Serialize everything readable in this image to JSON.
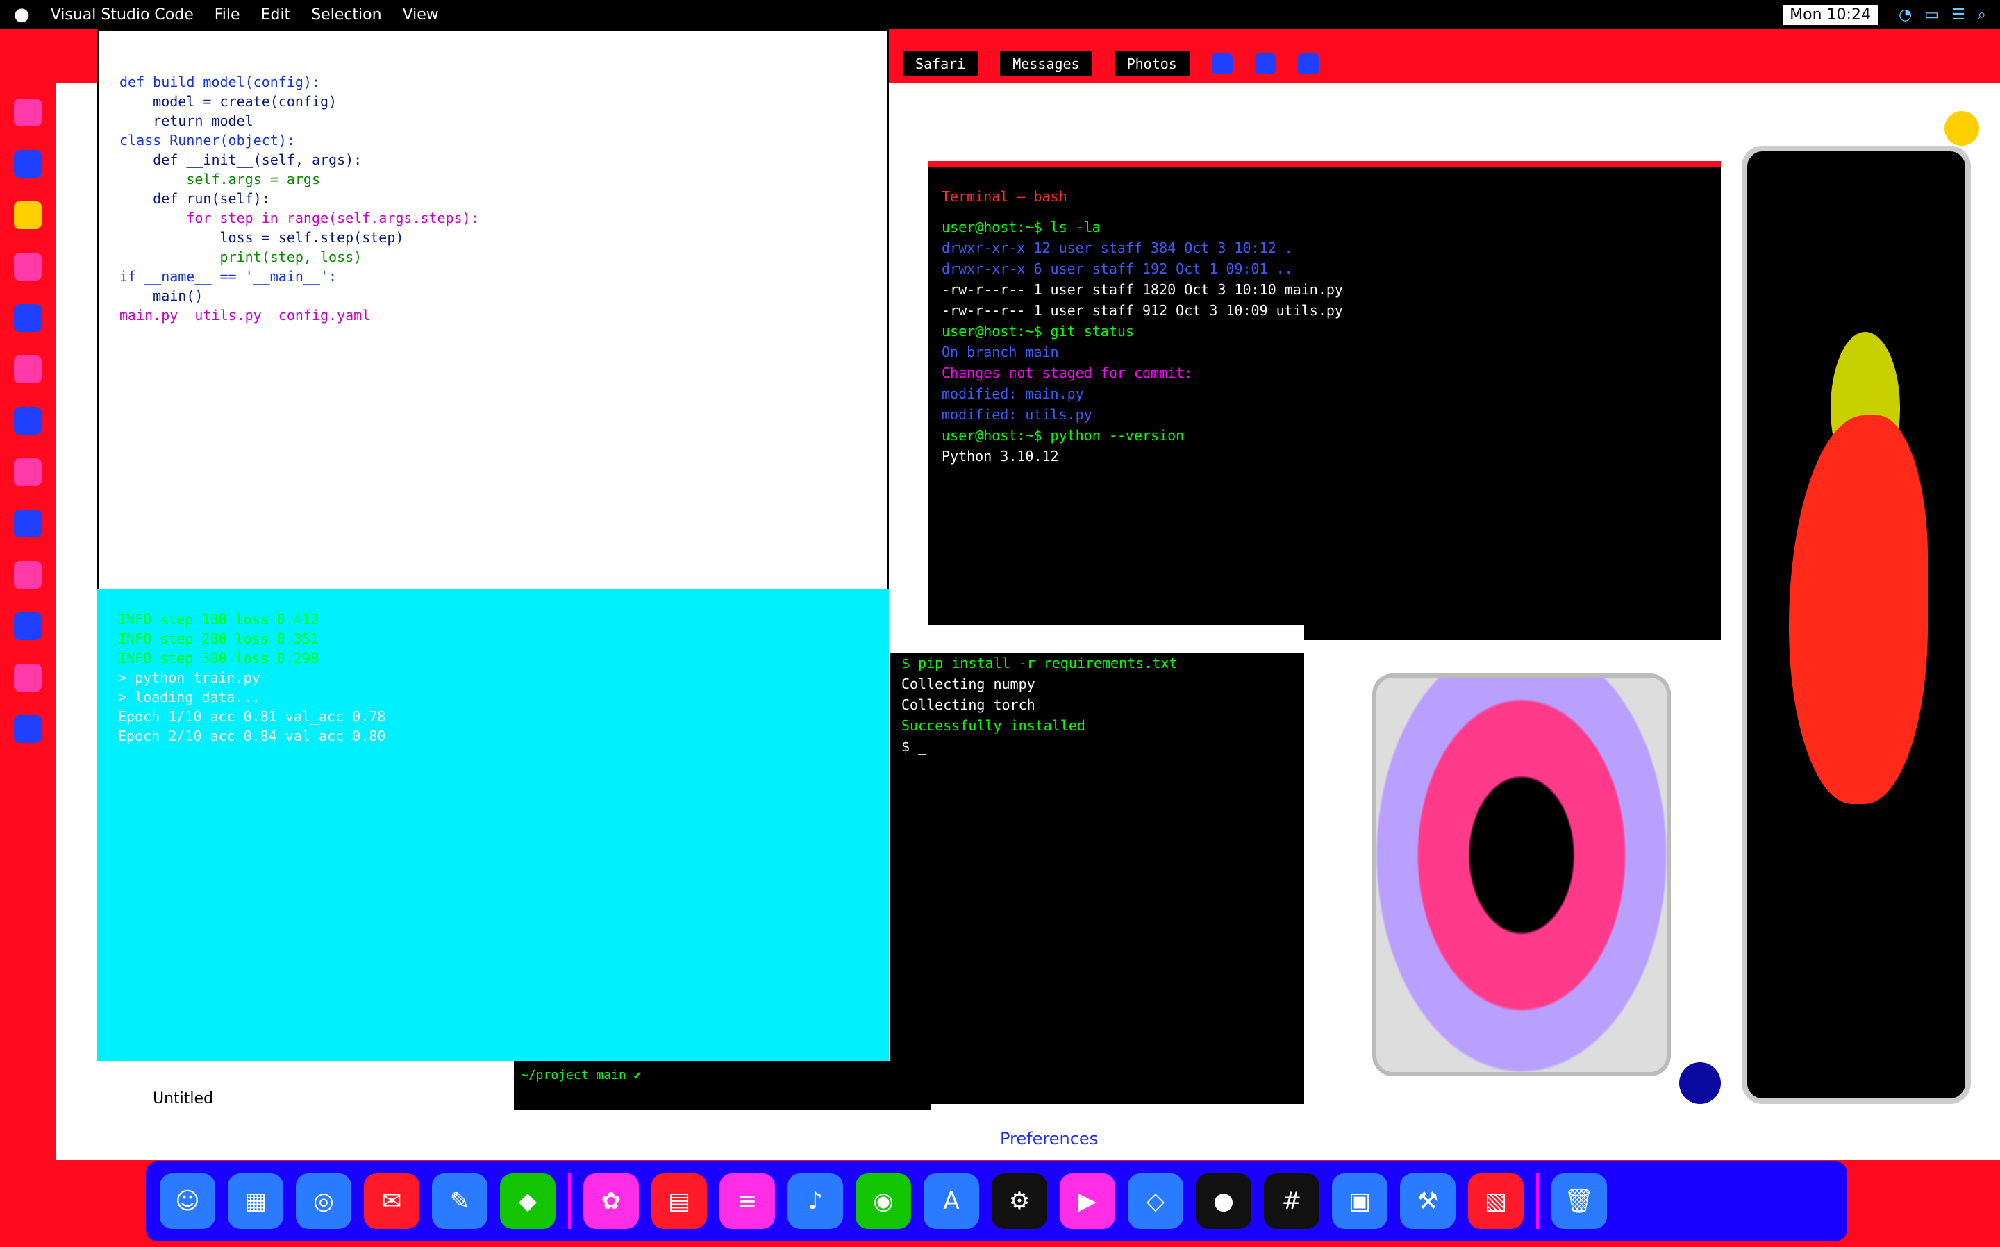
{
  "menubar": {
    "apple": "",
    "items": [
      "Visual Studio Code",
      "File",
      "Edit",
      "Selection",
      "View"
    ],
    "clock": "Mon 10:24",
    "status": [
      "wifi",
      "battery",
      "control-center",
      "spotlight",
      "siri"
    ]
  },
  "colors": {
    "desktop": "#ffffff",
    "frame": "#ff0a1e",
    "terminal": "#000000",
    "console": "#00f0ff",
    "dock": "#1a00ff"
  },
  "editor": {
    "lines": [
      "def build_model(config):",
      "    model = create(config)",
      "    return model",
      "",
      "class Runner(object):",
      "    def __init__(self, args):",
      "        self.args = args",
      "",
      "    def run(self):",
      "        for step in range(self.args.steps):",
      "            loss = self.step(step)",
      "            print(step, loss)",
      "",
      "if __name__ == '__main__':",
      "    main()"
    ],
    "tabbar": "main.py  utils.py  config.yaml"
  },
  "console": {
    "lines": [
      "INFO  step 100  loss 0.412",
      "INFO  step 200  loss 0.351",
      "INFO  step 300  loss 0.298",
      "",
      "> python train.py",
      "> loading data...",
      "",
      "Epoch 1/10  acc 0.81  val_acc 0.78",
      "Epoch 2/10  acc 0.84  val_acc 0.80"
    ]
  },
  "terminal_top": {
    "title": "Terminal — bash",
    "lines": [
      "user@host:~$ ls -la",
      "drwxr-xr-x  12 user  staff   384 Oct  3 10:12 .",
      "drwxr-xr-x   6 user  staff   192 Oct  1 09:01 ..",
      "-rw-r--r--   1 user  staff  1820 Oct  3 10:10 main.py",
      "-rw-r--r--   1 user  staff   912 Oct  3 10:09 utils.py",
      "user@host:~$ git status",
      "On branch main",
      "Changes not staged for commit:",
      "  modified:   main.py",
      "  modified:   utils.py",
      "user@host:~$ python --version",
      "Python 3.10.12"
    ]
  },
  "terminal_mid": {
    "lines": [
      "$ pip install -r requirements.txt",
      "Collecting numpy",
      "Collecting torch",
      "Successfully installed",
      "$ _"
    ]
  },
  "terminal_bottom": {
    "text": "~/project  main  ✔"
  },
  "tabs_right": [
    "Safari",
    "Messages",
    "Photos"
  ],
  "bottom_note": "Untitled",
  "bottom_link": "Preferences",
  "dock": {
    "apps": [
      "Finder",
      "Launchpad",
      "Safari",
      "Mail",
      "Messages",
      "Maps",
      "Photos",
      "Calendar",
      "Notes",
      "Music",
      "Podcasts",
      "App Store",
      "Settings",
      "Terminal",
      "Code",
      "Chrome",
      "Slack",
      "Zoom",
      "Xcode",
      "Preview",
      "Trash"
    ]
  }
}
